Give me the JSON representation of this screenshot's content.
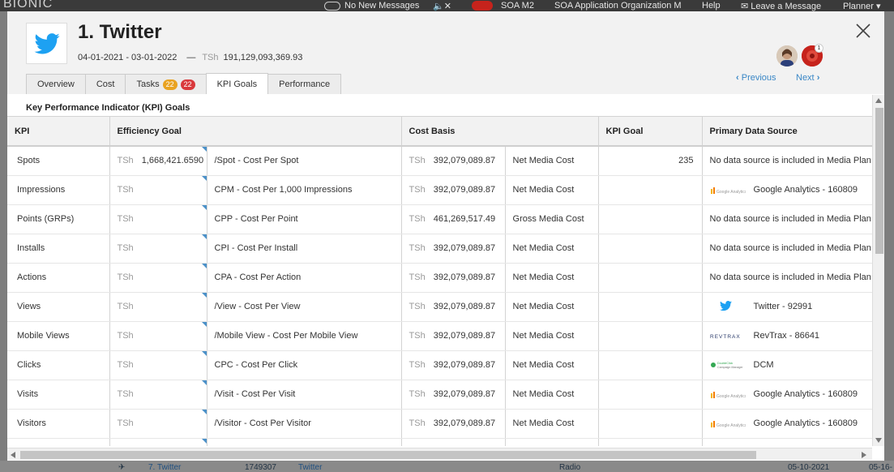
{
  "background": {
    "brand": "BIONIC",
    "topbar": {
      "messages": "No New Messages",
      "org_short": "SOA M2",
      "org_full": "SOA Application Organization M",
      "help": "Help",
      "leave_message": "Leave a Message",
      "planner": "Planner"
    },
    "bottom_row": {
      "label": "7. Twitter",
      "number": "1749307",
      "vendor": "Twitter",
      "media": "Radio",
      "date1": "05-10-2021",
      "date2": "05-16-"
    }
  },
  "modal": {
    "title": "1. Twitter",
    "date_range": "04-01-2021 - 03-01-2022",
    "dash": "—",
    "currency": "TSh",
    "total": "191,129,093,369.93",
    "notification_count": "1",
    "nav": {
      "previous": "Previous",
      "next": "Next"
    },
    "tabs": [
      {
        "label": "Overview"
      },
      {
        "label": "Cost"
      },
      {
        "label": "Tasks",
        "badge1": "22",
        "badge2": "22"
      },
      {
        "label": "KPI Goals"
      },
      {
        "label": "Performance"
      }
    ],
    "section_title": "Key Performance Indicator (KPI) Goals"
  },
  "table": {
    "headers": {
      "kpi": "KPI",
      "efficiency": "Efficiency Goal",
      "cost_basis": "Cost Basis",
      "kpi_goal": "KPI Goal",
      "source": "Primary Data Source"
    },
    "currency": "TSh",
    "rows": [
      {
        "kpi": "Spots",
        "eff_value": "1,668,421.6590",
        "eff_label": "/Spot - Cost Per Spot",
        "cost": "392,079,089.87",
        "cost_type": "Net Media Cost",
        "goal": "235",
        "source": "No data source is included in Media Plan",
        "source_icon": ""
      },
      {
        "kpi": "Impressions",
        "eff_value": "",
        "eff_label": "CPM - Cost Per 1,000 Impressions",
        "cost": "392,079,089.87",
        "cost_type": "Net Media Cost",
        "goal": "",
        "source": "Google Analytics - 160809",
        "source_icon": "google-analytics"
      },
      {
        "kpi": "Points (GRPs)",
        "eff_value": "",
        "eff_label": "CPP - Cost Per Point",
        "cost": "461,269,517.49",
        "cost_type": "Gross Media Cost",
        "goal": "",
        "source": "No data source is included in Media Plan",
        "source_icon": ""
      },
      {
        "kpi": "Installs",
        "eff_value": "",
        "eff_label": "CPI - Cost Per Install",
        "cost": "392,079,089.87",
        "cost_type": "Net Media Cost",
        "goal": "",
        "source": "No data source is included in Media Plan",
        "source_icon": ""
      },
      {
        "kpi": "Actions",
        "eff_value": "",
        "eff_label": "CPA - Cost Per Action",
        "cost": "392,079,089.87",
        "cost_type": "Net Media Cost",
        "goal": "",
        "source": "No data source is included in Media Plan",
        "source_icon": ""
      },
      {
        "kpi": "Views",
        "eff_value": "",
        "eff_label": "/View - Cost Per View",
        "cost": "392,079,089.87",
        "cost_type": "Net Media Cost",
        "goal": "",
        "source": "Twitter - 92991",
        "source_icon": "twitter"
      },
      {
        "kpi": "Mobile Views",
        "eff_value": "",
        "eff_label": "/Mobile View - Cost Per Mobile View",
        "cost": "392,079,089.87",
        "cost_type": "Net Media Cost",
        "goal": "",
        "source": "RevTrax - 86641",
        "source_icon": "revtrax"
      },
      {
        "kpi": "Clicks",
        "eff_value": "",
        "eff_label": "CPC - Cost Per Click",
        "cost": "392,079,089.87",
        "cost_type": "Net Media Cost",
        "goal": "",
        "source": "DCM",
        "source_icon": "doubleclick"
      },
      {
        "kpi": "Visits",
        "eff_value": "",
        "eff_label": "/Visit - Cost Per Visit",
        "cost": "392,079,089.87",
        "cost_type": "Net Media Cost",
        "goal": "",
        "source": "Google Analytics - 160809",
        "source_icon": "google-analytics"
      },
      {
        "kpi": "Visitors",
        "eff_value": "",
        "eff_label": "/Visitor - Cost Per Visitor",
        "cost": "392,079,089.87",
        "cost_type": "Net Media Cost",
        "goal": "",
        "source": "Google Analytics - 160809",
        "source_icon": "google-analytics"
      }
    ]
  },
  "colors": {
    "accent": "#3a87c6",
    "twitter": "#1da1f2",
    "badge_orange": "#e9a321",
    "badge_red": "#d9393c"
  }
}
